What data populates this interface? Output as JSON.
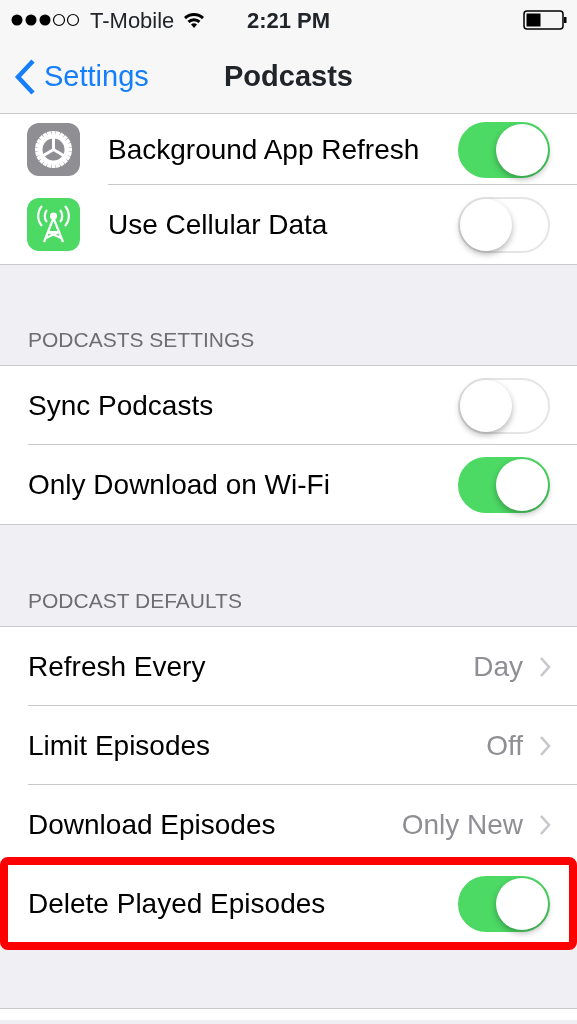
{
  "status_bar": {
    "carrier": "T-Mobile",
    "time": "2:21 PM"
  },
  "nav": {
    "back": "Settings",
    "title": "Podcasts"
  },
  "groups": [
    {
      "rows": [
        {
          "kind": "toggle",
          "label": "Background App Refresh",
          "on": true
        },
        {
          "kind": "toggle",
          "label": "Use Cellular Data",
          "on": false
        }
      ]
    },
    {
      "header": "PODCASTS SETTINGS",
      "rows": [
        {
          "kind": "toggle",
          "label": "Sync Podcasts",
          "on": false
        },
        {
          "kind": "toggle",
          "label": "Only Download on Wi-Fi",
          "on": true
        }
      ]
    },
    {
      "header": "PODCAST DEFAULTS",
      "rows": [
        {
          "kind": "disclosure",
          "label": "Refresh Every",
          "value": "Day"
        },
        {
          "kind": "disclosure",
          "label": "Limit Episodes",
          "value": "Off"
        },
        {
          "kind": "disclosure",
          "label": "Download Episodes",
          "value": "Only New"
        },
        {
          "kind": "toggle",
          "label": "Delete Played Episodes",
          "on": true,
          "highlighted": true
        }
      ]
    }
  ]
}
